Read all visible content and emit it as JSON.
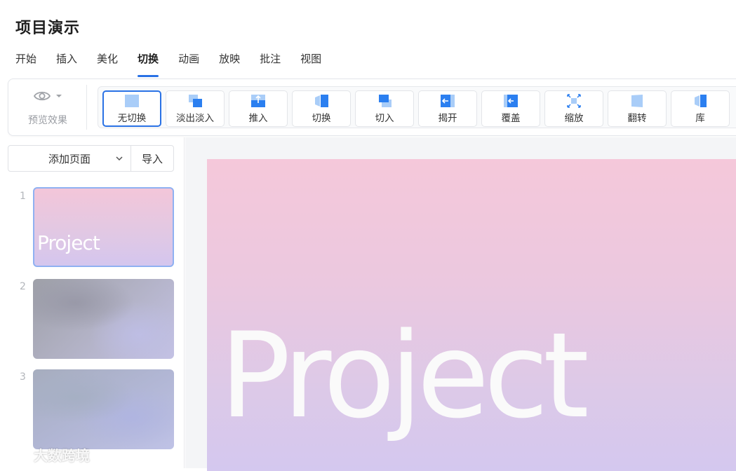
{
  "app": {
    "title": "项目演示"
  },
  "menu": {
    "tabs": [
      {
        "label": "开始"
      },
      {
        "label": "插入"
      },
      {
        "label": "美化"
      },
      {
        "label": "切换",
        "active": true
      },
      {
        "label": "动画"
      },
      {
        "label": "放映"
      },
      {
        "label": "批注"
      },
      {
        "label": "视图"
      }
    ]
  },
  "ribbon": {
    "preview": {
      "label": "预览效果",
      "icon": "eye-icon"
    },
    "transitions": [
      {
        "label": "无切换",
        "icon": "no-transition-icon",
        "selected": true
      },
      {
        "label": "淡出淡入",
        "icon": "fade-icon"
      },
      {
        "label": "推入",
        "icon": "push-icon"
      },
      {
        "label": "切换",
        "icon": "switch-icon"
      },
      {
        "label": "切入",
        "icon": "cut-in-icon"
      },
      {
        "label": "揭开",
        "icon": "uncover-icon"
      },
      {
        "label": "覆盖",
        "icon": "cover-icon"
      },
      {
        "label": "缩放",
        "icon": "zoom-icon"
      },
      {
        "label": "翻转",
        "icon": "flip-icon"
      },
      {
        "label": "库",
        "icon": "gallery-icon"
      }
    ]
  },
  "sidebar": {
    "add_page_label": "添加页面",
    "import_label": "导入",
    "slides": [
      {
        "number": "1",
        "title": "Project",
        "selected": true
      },
      {
        "number": "2",
        "title": ""
      },
      {
        "number": "3",
        "title": ""
      }
    ]
  },
  "canvas": {
    "slide_title": "Project"
  },
  "colors": {
    "accent": "#2a72e5",
    "icon_blue": "#2b7ff0",
    "icon_light": "#a9cdf8"
  },
  "watermark": {
    "text": "大数跨境"
  }
}
